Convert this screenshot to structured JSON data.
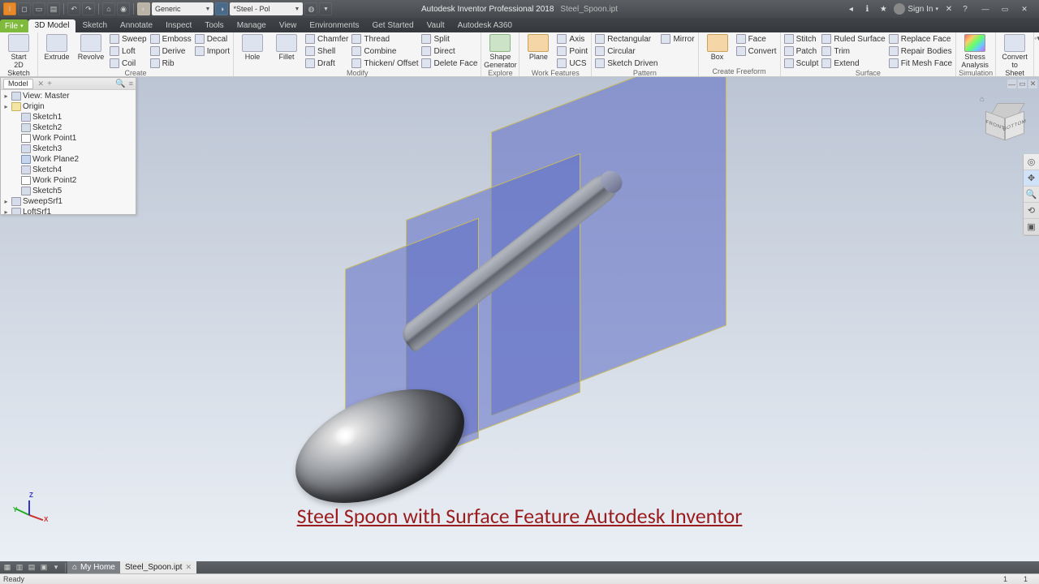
{
  "app": {
    "name": "Autodesk Inventor Professional 2018",
    "doc": "Steel_Spoon.ipt",
    "signin": "Sign In"
  },
  "qat": {
    "material_combo": "Generic",
    "appearance_combo": "*Steel - Pol"
  },
  "menutabs": [
    "File",
    "3D Model",
    "Sketch",
    "Annotate",
    "Inspect",
    "Tools",
    "Manage",
    "View",
    "Environments",
    "Get Started",
    "Vault",
    "Autodesk A360"
  ],
  "activeTab": 1,
  "ribbon": {
    "groups": [
      {
        "label": "Sketch",
        "big": [
          {
            "t": "Start\n2D Sketch"
          }
        ]
      },
      {
        "label": "Create",
        "big": [
          {
            "t": "Extrude"
          },
          {
            "t": "Revolve"
          }
        ],
        "stacks": [
          [
            {
              "t": "Sweep"
            },
            {
              "t": "Loft"
            },
            {
              "t": "Coil"
            }
          ],
          [
            {
              "t": "Emboss"
            },
            {
              "t": "Derive"
            },
            {
              "t": "Rib"
            }
          ],
          [
            {
              "t": "Decal"
            },
            {
              "t": "Import"
            }
          ]
        ]
      },
      {
        "label": "Modify",
        "big": [
          {
            "t": "Hole"
          },
          {
            "t": "Fillet"
          }
        ],
        "stacks": [
          [
            {
              "t": "Chamfer"
            },
            {
              "t": "Shell"
            },
            {
              "t": "Draft"
            }
          ],
          [
            {
              "t": "Thread"
            },
            {
              "t": "Combine"
            },
            {
              "t": "Thicken/ Offset"
            }
          ],
          [
            {
              "t": "Split"
            },
            {
              "t": "Direct"
            },
            {
              "t": "Delete Face"
            }
          ]
        ]
      },
      {
        "label": "Explore",
        "big": [
          {
            "t": "Shape\nGenerator",
            "c": "green"
          }
        ]
      },
      {
        "label": "Work Features",
        "big": [
          {
            "t": "Plane",
            "c": "orange"
          }
        ],
        "stacks": [
          [
            {
              "t": "Axis"
            },
            {
              "t": "Point"
            },
            {
              "t": "UCS"
            }
          ]
        ]
      },
      {
        "label": "Pattern",
        "stacks": [
          [
            {
              "t": "Rectangular"
            },
            {
              "t": "Circular"
            },
            {
              "t": "Sketch Driven"
            }
          ],
          [
            {
              "t": "Mirror"
            }
          ]
        ]
      },
      {
        "label": "Create Freeform",
        "big": [
          {
            "t": "Box",
            "c": "orange"
          }
        ],
        "stacks": [
          [
            {
              "t": "Face"
            },
            {
              "t": "Convert"
            }
          ]
        ]
      },
      {
        "label": "Surface",
        "stacks": [
          [
            {
              "t": "Stitch"
            },
            {
              "t": "Patch"
            },
            {
              "t": "Sculpt"
            }
          ],
          [
            {
              "t": "Ruled Surface"
            },
            {
              "t": "Trim"
            },
            {
              "t": "Extend"
            }
          ],
          [
            {
              "t": "Replace Face"
            },
            {
              "t": "Repair Bodies"
            },
            {
              "t": "Fit Mesh Face"
            }
          ]
        ]
      },
      {
        "label": "Simulation",
        "big": [
          {
            "t": "Stress\nAnalysis",
            "c": "rainbow"
          }
        ]
      },
      {
        "label": "Convert",
        "big": [
          {
            "t": "Convert to\nSheet Metal"
          }
        ]
      }
    ]
  },
  "browser": {
    "tab": "Model",
    "nodes": [
      {
        "t": "View: Master",
        "tw": "▸",
        "d": 0,
        "ic": ""
      },
      {
        "t": "Origin",
        "tw": "▸",
        "d": 0,
        "ic": "folder"
      },
      {
        "t": "Sketch1",
        "tw": "",
        "d": 1,
        "ic": ""
      },
      {
        "t": "Sketch2",
        "tw": "",
        "d": 1,
        "ic": ""
      },
      {
        "t": "Work Point1",
        "tw": "",
        "d": 1,
        "ic": "pt"
      },
      {
        "t": "Sketch3",
        "tw": "",
        "d": 1,
        "ic": ""
      },
      {
        "t": "Work Plane2",
        "tw": "",
        "d": 1,
        "ic": "pl"
      },
      {
        "t": "Sketch4",
        "tw": "",
        "d": 1,
        "ic": ""
      },
      {
        "t": "Work Point2",
        "tw": "",
        "d": 1,
        "ic": "pt"
      },
      {
        "t": "Sketch5",
        "tw": "",
        "d": 1,
        "ic": ""
      },
      {
        "t": "SweepSrf1",
        "tw": "▸",
        "d": 0,
        "ic": ""
      },
      {
        "t": "LoftSrf1",
        "tw": "▸",
        "d": 0,
        "ic": ""
      }
    ]
  },
  "caption": "Steel Spoon with Surface Feature Autodesk Inventor",
  "navcube": {
    "front": "FRONT",
    "side": "BOTTOM",
    "top": ""
  },
  "doctabs": {
    "home": "My Home",
    "active": "Steel_Spoon.ipt"
  },
  "status": {
    "left": "Ready",
    "r1": "1",
    "r2": "1"
  }
}
